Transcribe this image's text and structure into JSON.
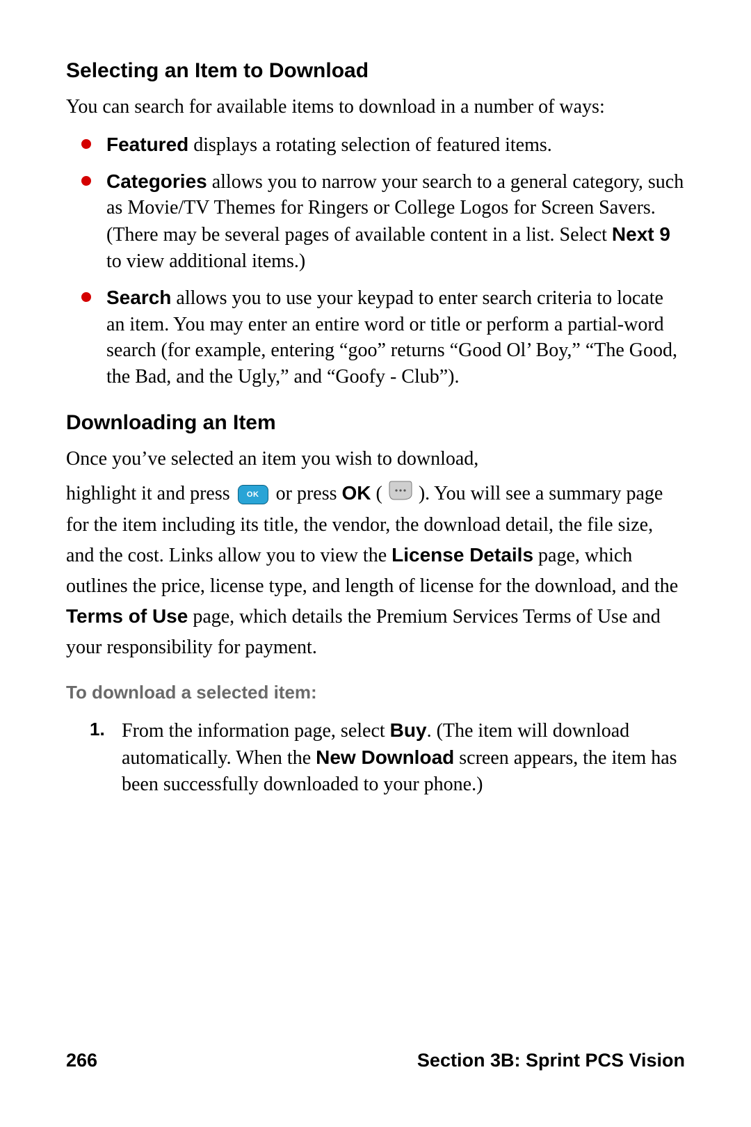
{
  "section1": {
    "heading": "Selecting an Item to Download",
    "intro": "You can search for available items to download in a number of ways:",
    "bullets": [
      {
        "term": "Featured",
        "text": " displays a rotating selection of featured items."
      },
      {
        "term": "Categories",
        "text_a": " allows you to narrow your search to a general category, such as Movie/TV Themes for Ringers or College Logos for Screen Savers. (There may be several pages of available content in a list. Select ",
        "bold_b": "Next 9",
        "text_c": " to view additional items.)"
      },
      {
        "term": "Search",
        "text": " allows you to use your keypad to enter search criteria to locate an item. You may enter an entire word or title or perform a partial-word search (for example, entering “goo” returns “Good Ol’ Boy,” “The Good, the Bad, and the Ugly,” and “Goofy - Club”)."
      }
    ]
  },
  "section2": {
    "heading": "Downloading an Item",
    "p1": "Once you’ve selected an item you wish to download,",
    "p2_a": "highlight it and press ",
    "p2_b": " or press ",
    "p2_ok": "OK",
    "p2_c": " (",
    "p2_d": "). You will see a summary page for the item including its title, the vendor, the download detail, the file size, and the cost. Links allow you to view the ",
    "p2_bold1": "License Details",
    "p2_e": " page, which outlines the price, license type, and length of license for the download, and the ",
    "p2_bold2": "Terms of Use",
    "p2_f": " page, which details the Premium Services Terms of Use and your responsibility for payment.",
    "sub": "To download a selected item:",
    "step1": {
      "num": "1.",
      "a": "From the information page, select ",
      "b1": "Buy",
      "b": ". (The item will download automatically. When the ",
      "b2": "New Download",
      "c": " screen appears, the item has been successfully downloaded to your phone.)"
    }
  },
  "footer": {
    "page": "266",
    "section": "Section 3B: Sprint PCS Vision"
  }
}
